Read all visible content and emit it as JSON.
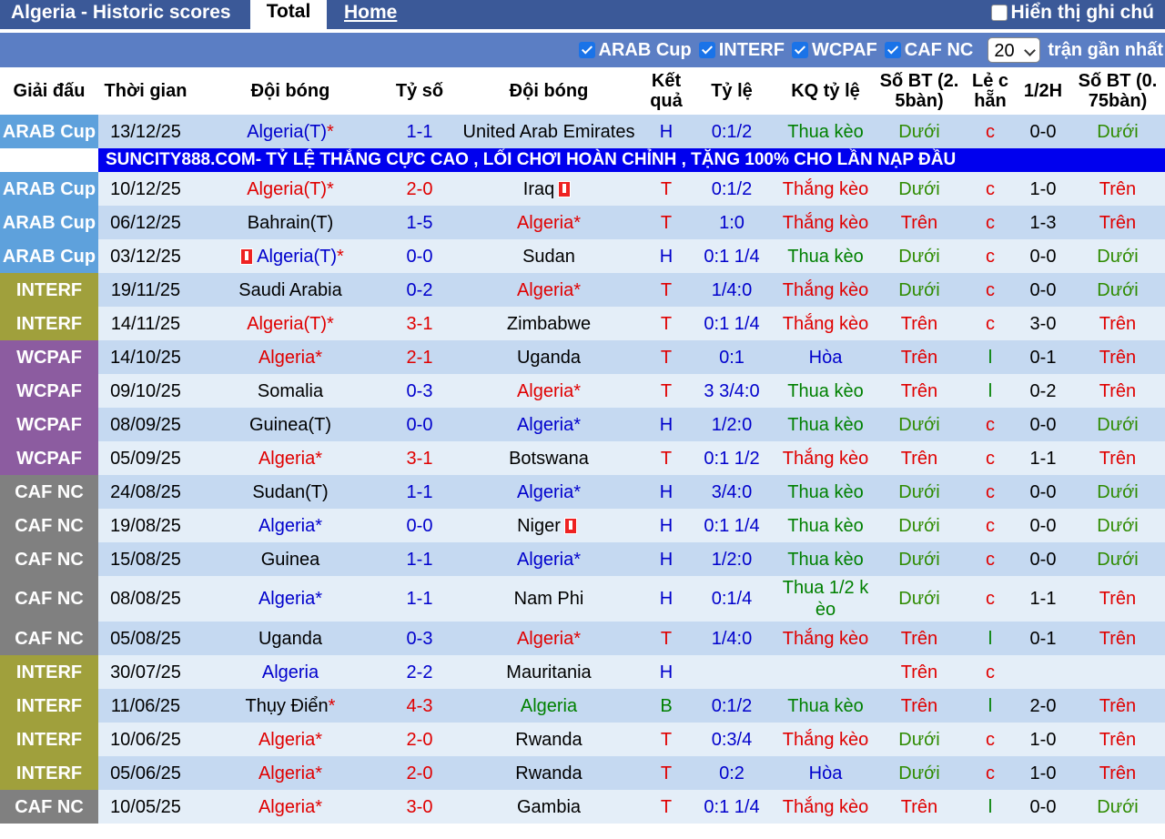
{
  "tabs": {
    "title": "Algeria - Historic scores",
    "total": "Total",
    "home": "Home",
    "note": "Hiển thị ghi chú"
  },
  "filters": {
    "items": [
      "ARAB Cup",
      "INTERF",
      "WCPAF",
      "CAF NC"
    ],
    "count": "20",
    "suffix": "trận gần nhất"
  },
  "headers": [
    "Giải đấu",
    "Thời gian",
    "Đội bóng",
    "Tỷ số",
    "Đội bóng",
    "Kết quả",
    "Tỷ lệ",
    "KQ tỷ lệ",
    "Số BT (2. 5bàn)",
    "Lẻ c hẵn",
    "1/2H",
    "Số BT (0. 75bàn)"
  ],
  "ad_text": "SUNCITY888.COM- TỶ LỆ THẮNG CỰC CAO , LỐI CHƠI HOÀN CHỈNH , TẶNG 100% CHO LẦN NẠP ĐẦU",
  "colors": {
    "ARAB Cup": "#5ea1dc",
    "INTERF": "#a0a03c",
    "WCPAF": "#8c5ca0",
    "CAF NC": "#808080",
    "header_bar": "#3b5998",
    "filter_bar": "#5b7ec4"
  },
  "rows": [
    {
      "league": "ARAB Cup",
      "date": "13/12/25",
      "home": "Algeria(T)",
      "home_star": "*",
      "home_color": "c-blue",
      "home_flag": false,
      "score": "1-1",
      "score_color": "c-blue",
      "away": "United Arab Emirates",
      "away_color": "c-black",
      "away_flag": false,
      "result": "H",
      "result_color": "c-blue",
      "odds": "0:1/2",
      "kq": "Thua kèo",
      "kq_color": "c-green",
      "bt25": "Dưới",
      "bt25_color": "c-dgreen",
      "lc": "c",
      "lc_color": "c-red",
      "half": "0-0",
      "bt075": "Dưới",
      "bt075_color": "c-dgreen"
    },
    {
      "league": "ARAB Cup",
      "date": "10/12/25",
      "home": "Algeria(T)",
      "home_star": "*",
      "home_color": "c-red",
      "home_flag": false,
      "score": "2-0",
      "score_color": "c-red",
      "away": "Iraq",
      "away_color": "c-black",
      "away_flag": true,
      "result": "T",
      "result_color": "c-red",
      "odds": "0:1/2",
      "kq": "Thắng kèo",
      "kq_color": "c-red",
      "bt25": "Dưới",
      "bt25_color": "c-dgreen",
      "lc": "c",
      "lc_color": "c-red",
      "half": "1-0",
      "bt075": "Trên",
      "bt075_color": "c-red"
    },
    {
      "league": "ARAB Cup",
      "date": "06/12/25",
      "home": "Bahrain(T)",
      "home_star": "",
      "home_color": "c-black",
      "home_flag": false,
      "score": "1-5",
      "score_color": "c-blue",
      "away": "Algeria*",
      "away_color": "c-red",
      "away_flag": false,
      "result": "T",
      "result_color": "c-red",
      "odds": "1:0",
      "kq": "Thắng kèo",
      "kq_color": "c-red",
      "bt25": "Trên",
      "bt25_color": "c-red",
      "lc": "c",
      "lc_color": "c-red",
      "half": "1-3",
      "bt075": "Trên",
      "bt075_color": "c-red"
    },
    {
      "league": "ARAB Cup",
      "date": "03/12/25",
      "home": "Algeria(T)",
      "home_star": "*",
      "home_color": "c-blue",
      "home_flag": true,
      "score": "0-0",
      "score_color": "c-blue",
      "away": "Sudan",
      "away_color": "c-black",
      "away_flag": false,
      "result": "H",
      "result_color": "c-blue",
      "odds": "0:1 1/4",
      "kq": "Thua kèo",
      "kq_color": "c-green",
      "bt25": "Dưới",
      "bt25_color": "c-dgreen",
      "lc": "c",
      "lc_color": "c-red",
      "half": "0-0",
      "bt075": "Dưới",
      "bt075_color": "c-dgreen"
    },
    {
      "league": "INTERF",
      "date": "19/11/25",
      "home": "Saudi Arabia",
      "home_star": "",
      "home_color": "c-black",
      "home_flag": false,
      "score": "0-2",
      "score_color": "c-blue",
      "away": "Algeria*",
      "away_color": "c-red",
      "away_flag": false,
      "result": "T",
      "result_color": "c-red",
      "odds": "1/4:0",
      "kq": "Thắng kèo",
      "kq_color": "c-red",
      "bt25": "Dưới",
      "bt25_color": "c-dgreen",
      "lc": "c",
      "lc_color": "c-red",
      "half": "0-0",
      "bt075": "Dưới",
      "bt075_color": "c-dgreen"
    },
    {
      "league": "INTERF",
      "date": "14/11/25",
      "home": "Algeria(T)",
      "home_star": "*",
      "home_color": "c-red",
      "home_flag": false,
      "score": "3-1",
      "score_color": "c-red",
      "away": "Zimbabwe",
      "away_color": "c-black",
      "away_flag": false,
      "result": "T",
      "result_color": "c-red",
      "odds": "0:1 1/4",
      "kq": "Thắng kèo",
      "kq_color": "c-red",
      "bt25": "Trên",
      "bt25_color": "c-red",
      "lc": "c",
      "lc_color": "c-red",
      "half": "3-0",
      "bt075": "Trên",
      "bt075_color": "c-red"
    },
    {
      "league": "WCPAF",
      "date": "14/10/25",
      "home": "Algeria*",
      "home_star": "",
      "home_color": "c-red",
      "home_flag": false,
      "score": "2-1",
      "score_color": "c-red",
      "away": "Uganda",
      "away_color": "c-black",
      "away_flag": false,
      "result": "T",
      "result_color": "c-red",
      "odds": "0:1",
      "kq": "Hòa",
      "kq_color": "c-blue",
      "bt25": "Trên",
      "bt25_color": "c-red",
      "lc": "l",
      "lc_color": "c-green",
      "half": "0-1",
      "bt075": "Trên",
      "bt075_color": "c-red"
    },
    {
      "league": "WCPAF",
      "date": "09/10/25",
      "home": "Somalia",
      "home_star": "",
      "home_color": "c-black",
      "home_flag": false,
      "score": "0-3",
      "score_color": "c-blue",
      "away": "Algeria*",
      "away_color": "c-red",
      "away_flag": false,
      "result": "T",
      "result_color": "c-red",
      "odds": "3 3/4:0",
      "kq": "Thua kèo",
      "kq_color": "c-green",
      "bt25": "Trên",
      "bt25_color": "c-red",
      "lc": "l",
      "lc_color": "c-green",
      "half": "0-2",
      "bt075": "Trên",
      "bt075_color": "c-red"
    },
    {
      "league": "WCPAF",
      "date": "08/09/25",
      "home": "Guinea(T)",
      "home_star": "",
      "home_color": "c-black",
      "home_flag": false,
      "score": "0-0",
      "score_color": "c-blue",
      "away": "Algeria*",
      "away_color": "c-blue",
      "away_flag": false,
      "result": "H",
      "result_color": "c-blue",
      "odds": "1/2:0",
      "kq": "Thua kèo",
      "kq_color": "c-green",
      "bt25": "Dưới",
      "bt25_color": "c-dgreen",
      "lc": "c",
      "lc_color": "c-red",
      "half": "0-0",
      "bt075": "Dưới",
      "bt075_color": "c-dgreen"
    },
    {
      "league": "WCPAF",
      "date": "05/09/25",
      "home": "Algeria*",
      "home_star": "",
      "home_color": "c-red",
      "home_flag": false,
      "score": "3-1",
      "score_color": "c-red",
      "away": "Botswana",
      "away_color": "c-black",
      "away_flag": false,
      "result": "T",
      "result_color": "c-red",
      "odds": "0:1 1/2",
      "kq": "Thắng kèo",
      "kq_color": "c-red",
      "bt25": "Trên",
      "bt25_color": "c-red",
      "lc": "c",
      "lc_color": "c-red",
      "half": "1-1",
      "bt075": "Trên",
      "bt075_color": "c-red"
    },
    {
      "league": "CAF NC",
      "date": "24/08/25",
      "home": "Sudan(T)",
      "home_star": "",
      "home_color": "c-black",
      "home_flag": false,
      "score": "1-1",
      "score_color": "c-blue",
      "away": "Algeria*",
      "away_color": "c-blue",
      "away_flag": false,
      "result": "H",
      "result_color": "c-blue",
      "odds": "3/4:0",
      "kq": "Thua kèo",
      "kq_color": "c-green",
      "bt25": "Dưới",
      "bt25_color": "c-dgreen",
      "lc": "c",
      "lc_color": "c-red",
      "half": "0-0",
      "bt075": "Dưới",
      "bt075_color": "c-dgreen"
    },
    {
      "league": "CAF NC",
      "date": "19/08/25",
      "home": "Algeria*",
      "home_star": "",
      "home_color": "c-blue",
      "home_flag": false,
      "score": "0-0",
      "score_color": "c-blue",
      "away": "Niger",
      "away_color": "c-black",
      "away_flag": true,
      "result": "H",
      "result_color": "c-blue",
      "odds": "0:1 1/4",
      "kq": "Thua kèo",
      "kq_color": "c-green",
      "bt25": "Dưới",
      "bt25_color": "c-dgreen",
      "lc": "c",
      "lc_color": "c-red",
      "half": "0-0",
      "bt075": "Dưới",
      "bt075_color": "c-dgreen"
    },
    {
      "league": "CAF NC",
      "date": "15/08/25",
      "home": "Guinea",
      "home_star": "",
      "home_color": "c-black",
      "home_flag": false,
      "score": "1-1",
      "score_color": "c-blue",
      "away": "Algeria*",
      "away_color": "c-blue",
      "away_flag": false,
      "result": "H",
      "result_color": "c-blue",
      "odds": "1/2:0",
      "kq": "Thua kèo",
      "kq_color": "c-green",
      "bt25": "Dưới",
      "bt25_color": "c-dgreen",
      "lc": "c",
      "lc_color": "c-red",
      "half": "0-0",
      "bt075": "Dưới",
      "bt075_color": "c-dgreen"
    },
    {
      "league": "CAF NC",
      "date": "08/08/25",
      "home": "Algeria*",
      "home_star": "",
      "home_color": "c-blue",
      "home_flag": false,
      "score": "1-1",
      "score_color": "c-blue",
      "away": "Nam Phi",
      "away_color": "c-black",
      "away_flag": false,
      "result": "H",
      "result_color": "c-blue",
      "odds": "0:1/4",
      "kq": "Thua 1/2 k èo",
      "kq_color": "c-green",
      "bt25": "Dưới",
      "bt25_color": "c-dgreen",
      "lc": "c",
      "lc_color": "c-red",
      "half": "1-1",
      "bt075": "Trên",
      "bt075_color": "c-red",
      "tall": true
    },
    {
      "league": "CAF NC",
      "date": "05/08/25",
      "home": "Uganda",
      "home_star": "",
      "home_color": "c-black",
      "home_flag": false,
      "score": "0-3",
      "score_color": "c-blue",
      "away": "Algeria*",
      "away_color": "c-red",
      "away_flag": false,
      "result": "T",
      "result_color": "c-red",
      "odds": "1/4:0",
      "kq": "Thắng kèo",
      "kq_color": "c-red",
      "bt25": "Trên",
      "bt25_color": "c-red",
      "lc": "l",
      "lc_color": "c-green",
      "half": "0-1",
      "bt075": "Trên",
      "bt075_color": "c-red"
    },
    {
      "league": "INTERF",
      "date": "30/07/25",
      "home": "Algeria",
      "home_star": "",
      "home_color": "c-blue",
      "home_flag": false,
      "score": "2-2",
      "score_color": "c-blue",
      "away": "Mauritania",
      "away_color": "c-black",
      "away_flag": false,
      "result": "H",
      "result_color": "c-blue",
      "odds": "",
      "kq": "",
      "kq_color": "c-green",
      "bt25": "Trên",
      "bt25_color": "c-red",
      "lc": "c",
      "lc_color": "c-red",
      "half": "",
      "bt075": "",
      "bt075_color": "c-red"
    },
    {
      "league": "INTERF",
      "date": "11/06/25",
      "home": "Thụy Điển",
      "home_star": "*",
      "home_color": "c-black",
      "home_flag": false,
      "score": "4-3",
      "score_color": "c-red",
      "away": "Algeria",
      "away_color": "c-green",
      "away_flag": false,
      "result": "B",
      "result_color": "c-green",
      "odds": "0:1/2",
      "kq": "Thua kèo",
      "kq_color": "c-green",
      "bt25": "Trên",
      "bt25_color": "c-red",
      "lc": "l",
      "lc_color": "c-green",
      "half": "2-0",
      "bt075": "Trên",
      "bt075_color": "c-red"
    },
    {
      "league": "INTERF",
      "date": "10/06/25",
      "home": "Algeria*",
      "home_star": "",
      "home_color": "c-red",
      "home_flag": false,
      "score": "2-0",
      "score_color": "c-red",
      "away": "Rwanda",
      "away_color": "c-black",
      "away_flag": false,
      "result": "T",
      "result_color": "c-red",
      "odds": "0:3/4",
      "kq": "Thắng kèo",
      "kq_color": "c-red",
      "bt25": "Dưới",
      "bt25_color": "c-dgreen",
      "lc": "c",
      "lc_color": "c-red",
      "half": "1-0",
      "bt075": "Trên",
      "bt075_color": "c-red"
    },
    {
      "league": "INTERF",
      "date": "05/06/25",
      "home": "Algeria*",
      "home_star": "",
      "home_color": "c-red",
      "home_flag": false,
      "score": "2-0",
      "score_color": "c-red",
      "away": "Rwanda",
      "away_color": "c-black",
      "away_flag": false,
      "result": "T",
      "result_color": "c-red",
      "odds": "0:2",
      "kq": "Hòa",
      "kq_color": "c-blue",
      "bt25": "Dưới",
      "bt25_color": "c-dgreen",
      "lc": "c",
      "lc_color": "c-red",
      "half": "1-0",
      "bt075": "Trên",
      "bt075_color": "c-red"
    },
    {
      "league": "CAF NC",
      "date": "10/05/25",
      "home": "Algeria*",
      "home_star": "",
      "home_color": "c-red",
      "home_flag": false,
      "score": "3-0",
      "score_color": "c-red",
      "away": "Gambia",
      "away_color": "c-black",
      "away_flag": false,
      "result": "T",
      "result_color": "c-red",
      "odds": "0:1 1/4",
      "kq": "Thắng kèo",
      "kq_color": "c-red",
      "bt25": "Trên",
      "bt25_color": "c-red",
      "lc": "l",
      "lc_color": "c-green",
      "half": "0-0",
      "bt075": "Dưới",
      "bt075_color": "c-dgreen"
    }
  ]
}
